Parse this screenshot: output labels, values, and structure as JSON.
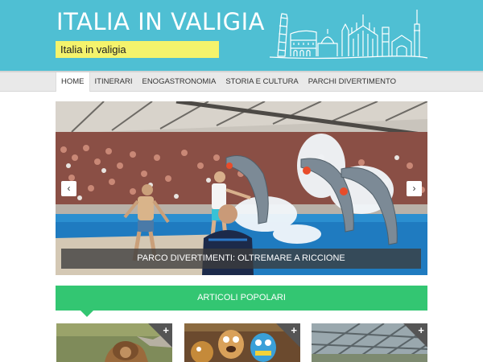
{
  "header": {
    "title": "ITALIA IN VALIGIA",
    "tagline": "Italia in valigia",
    "skyline_icon": "italian-landmarks-skyline-icon",
    "background": "#4fbfd3",
    "tagline_background": "#f4f36c"
  },
  "nav": {
    "items": [
      {
        "label": "HOME",
        "active": true
      },
      {
        "label": "ITINERARI",
        "active": false
      },
      {
        "label": "ENOGASTRONOMIA",
        "active": false
      },
      {
        "label": "STORIA E CULTURA",
        "active": false
      },
      {
        "label": "PARCHI DIVERTIMENTO",
        "active": false
      }
    ]
  },
  "slider": {
    "prev_icon": "chevron-left-icon",
    "next_icon": "chevron-right-icon",
    "prev_glyph": "‹",
    "next_glyph": "›",
    "caption": "PARCO DIVERTIMENTI: OLTREMARE A RICCIONE"
  },
  "popular": {
    "title": "ARTICOLI POPOLARI",
    "color": "#33c672",
    "plus_glyph": "+",
    "thumbnails": [
      {
        "icon": "lion-photo"
      },
      {
        "icon": "mascots-photo"
      },
      {
        "icon": "greenhouse-photo"
      }
    ]
  }
}
